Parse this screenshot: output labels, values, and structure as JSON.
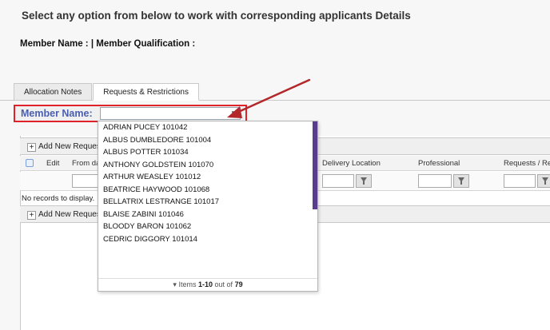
{
  "header": {
    "title": "Select any option from below to work with corresponding applicants Details",
    "member_info": "Member Name :  | Member Qualification :"
  },
  "tabs": [
    {
      "label": "Allocation Notes",
      "active": false
    },
    {
      "label": "Requests & Restrictions",
      "active": true
    }
  ],
  "member_selector": {
    "label": "Member Name:",
    "value": "",
    "highlight_color": "#e0222a"
  },
  "grid": {
    "add_button_label": "Add New Reques",
    "columns": {
      "edit": "Edit",
      "from_date": "From da",
      "delivery_location": "Delivery Location",
      "professional": "Professional",
      "requests": "Requests / Re"
    },
    "empty_message": "No records to display."
  },
  "dropdown": {
    "items": [
      "ADRIAN PUCEY 101042",
      "ALBUS DUMBLEDORE 101004",
      "ALBUS POTTER 101034",
      "ANTHONY GOLDSTEIN 101070",
      "ARTHUR WEASLEY 101012",
      "BEATRICE HAYWOOD 101068",
      "BELLATRIX LESTRANGE 101017",
      "BLAISE ZABINI 101046",
      "BLOODY BARON 101062",
      "CEDRIC DIGGORY 101014"
    ],
    "footer_prefix": "Items",
    "footer_range": "1-10",
    "footer_middle": "out of",
    "footer_total": "79",
    "scroll_color": "#5a3c8c"
  },
  "annotation": {
    "arrow_color": "#b3282a"
  }
}
